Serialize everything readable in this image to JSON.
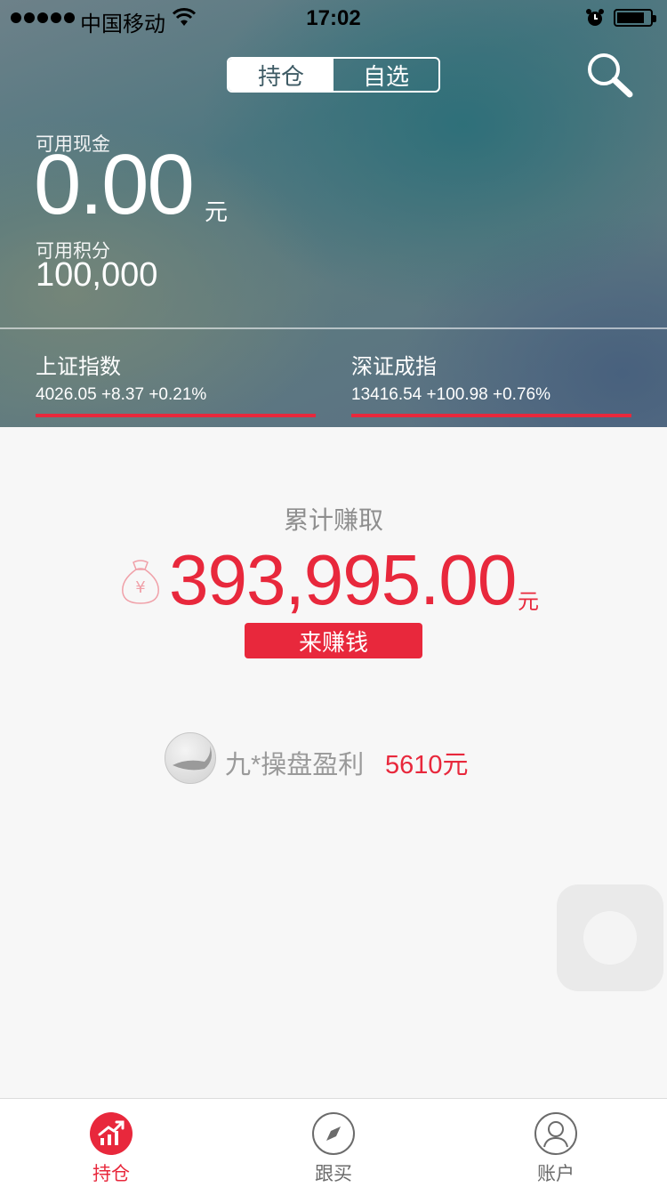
{
  "status_bar": {
    "carrier": "中国移动",
    "time": "17:02",
    "icons": [
      "signal-dots-icon",
      "wifi-icon",
      "alarm-icon",
      "battery-icon"
    ]
  },
  "header": {
    "tabs": [
      {
        "label": "持仓",
        "active": true
      },
      {
        "label": "自选",
        "active": false
      }
    ],
    "search_icon": "search-icon"
  },
  "account": {
    "cash_label": "可用现金",
    "cash_value": "0.00",
    "cash_unit": "元",
    "points_label": "可用积分",
    "points_value": "100,000"
  },
  "indices": [
    {
      "name": "上证指数",
      "quote": "4026.05 +8.37 +0.21%"
    },
    {
      "name": "深证成指",
      "quote": "13416.54 +100.98 +0.76%"
    }
  ],
  "earnings": {
    "label": "累计赚取",
    "value": "393,995.00",
    "unit": "元",
    "button": "来赚钱",
    "icon": "money-bag-icon"
  },
  "promo": {
    "text": "九*操盘盈利",
    "amount": "5610元"
  },
  "tabbar": [
    {
      "label": "持仓",
      "icon": "holdings-chart-icon",
      "active": true
    },
    {
      "label": "跟买",
      "icon": "compass-icon",
      "active": false
    },
    {
      "label": "账户",
      "icon": "user-icon",
      "active": false
    }
  ],
  "colors": {
    "accent_red": "#e8283c",
    "hero_bg": "#577880",
    "page_bg": "#f7f7f7",
    "muted_text": "#8e8e8e"
  }
}
